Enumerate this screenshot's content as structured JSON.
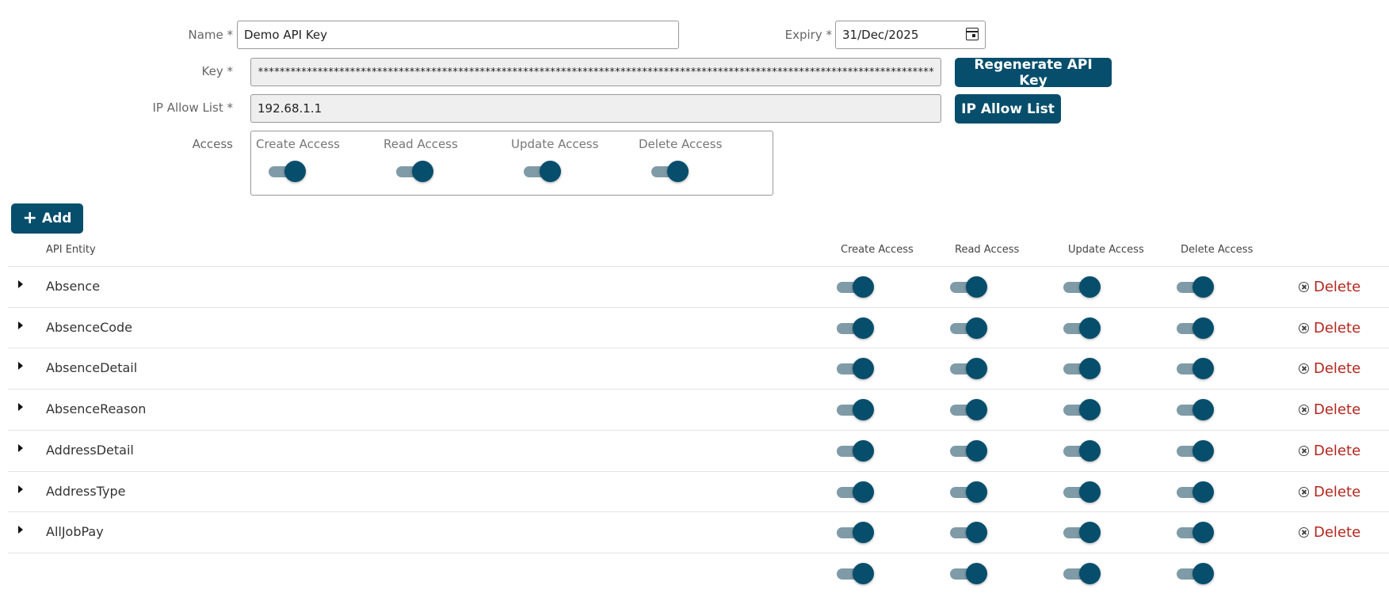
{
  "form": {
    "name_label": "Name *",
    "name_value": "Demo API Key",
    "expiry_label": "Expiry *",
    "expiry_value": "31/Dec/2025",
    "key_label": "Key *",
    "key_value": "**************************************************************************************************************************************",
    "ip_label": "IP Allow List *",
    "ip_value": "192.68.1.1",
    "access_label": "Access",
    "regenerate_label": "Regenerate API Key",
    "ip_button_label": "IP Allow List"
  },
  "access": {
    "create": "Create Access",
    "read": "Read Access",
    "update": "Update Access",
    "delete": "Delete Access"
  },
  "toolbar": {
    "add_label": "Add",
    "add_icon": "plus-icon"
  },
  "table": {
    "headers": {
      "entity": "API Entity",
      "create": "Create Access",
      "read": "Read Access",
      "update": "Update Access",
      "delete": "Delete Access"
    },
    "delete_label": "Delete",
    "rows": [
      {
        "name": "Absence"
      },
      {
        "name": "AbsenceCode"
      },
      {
        "name": "AbsenceDetail"
      },
      {
        "name": "AbsenceReason"
      },
      {
        "name": "AddressDetail"
      },
      {
        "name": "AddressType"
      },
      {
        "name": "AllJobPay"
      }
    ]
  },
  "colors": {
    "primary": "#064e6c",
    "toggle_track": "#7f9ba7",
    "delete": "#b3261e"
  }
}
